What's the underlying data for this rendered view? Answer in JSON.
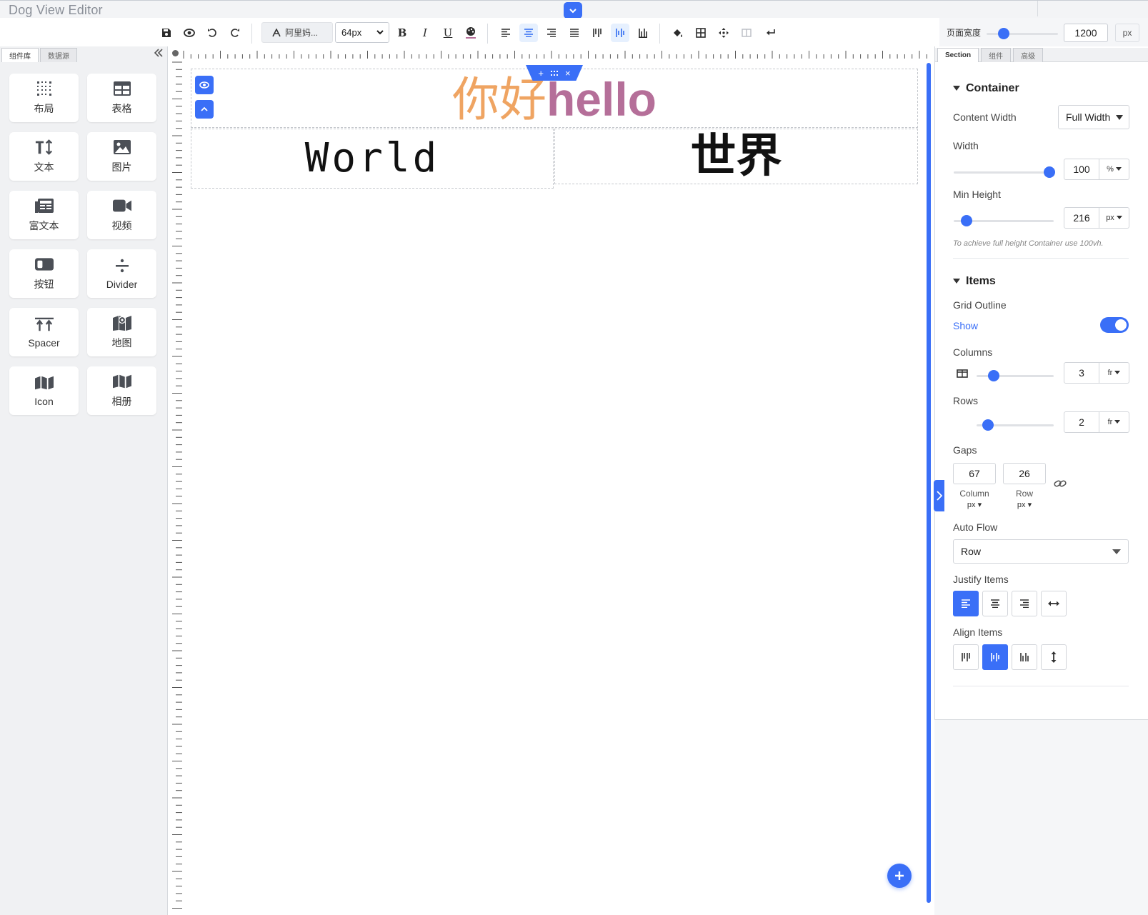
{
  "app": {
    "title": "Dog View Editor"
  },
  "toolbar": {
    "font_family": "阿里妈...",
    "font_size": "64px"
  },
  "page_width": {
    "label": "页面宽度",
    "value": "1200",
    "unit": "px"
  },
  "sidebar": {
    "tabs": [
      {
        "label": "组件库",
        "active": true
      },
      {
        "label": "数据源",
        "active": false
      }
    ],
    "components": [
      {
        "label": "布局",
        "icon": "grid-dots-icon"
      },
      {
        "label": "表格",
        "icon": "table-icon"
      },
      {
        "label": "文本",
        "icon": "text-size-icon"
      },
      {
        "label": "图片",
        "icon": "image-icon"
      },
      {
        "label": "富文本",
        "icon": "newspaper-icon"
      },
      {
        "label": "视频",
        "icon": "video-icon"
      },
      {
        "label": "按钮",
        "icon": "button-icon"
      },
      {
        "label": "Divider",
        "icon": "divide-icon"
      },
      {
        "label": "Spacer",
        "icon": "spacer-icon"
      },
      {
        "label": "地图",
        "icon": "map-pin-icon"
      },
      {
        "label": "Icon",
        "icon": "map-icon"
      },
      {
        "label": "相册",
        "icon": "album-icon"
      }
    ]
  },
  "canvas": {
    "heading_cn": "你好",
    "heading_en": "hello",
    "cell_left_text": "World",
    "cell_right_text": "世界",
    "colors": {
      "heading_cn": "#efa462",
      "heading_en": "#b56f99",
      "accent": "#3a6ff7"
    }
  },
  "right_panel": {
    "tabs": [
      {
        "label": "Section",
        "active": true
      },
      {
        "label": "组件",
        "active": false
      },
      {
        "label": "高级",
        "active": false
      }
    ],
    "container": {
      "heading": "Container",
      "content_width_label": "Content Width",
      "content_width_value": "Full Width",
      "width_label": "Width",
      "width_value": "100",
      "width_unit": "%",
      "min_height_label": "Min Height",
      "min_height_value": "216",
      "min_height_unit": "px",
      "note": "To achieve full height Container use 100vh."
    },
    "items": {
      "heading": "Items",
      "grid_outline_label": "Grid Outline",
      "grid_outline_state": "Show",
      "columns_label": "Columns",
      "columns_value": "3",
      "columns_unit": "fr",
      "rows_label": "Rows",
      "rows_value": "2",
      "rows_unit": "fr",
      "gaps_label": "Gaps",
      "gap_column_value": "67",
      "gap_column_label": "Column",
      "gap_column_unit": "px",
      "gap_row_value": "26",
      "gap_row_label": "Row",
      "gap_row_unit": "px",
      "auto_flow_label": "Auto Flow",
      "auto_flow_value": "Row",
      "justify_items_label": "Justify Items",
      "align_items_label": "Align Items"
    }
  }
}
